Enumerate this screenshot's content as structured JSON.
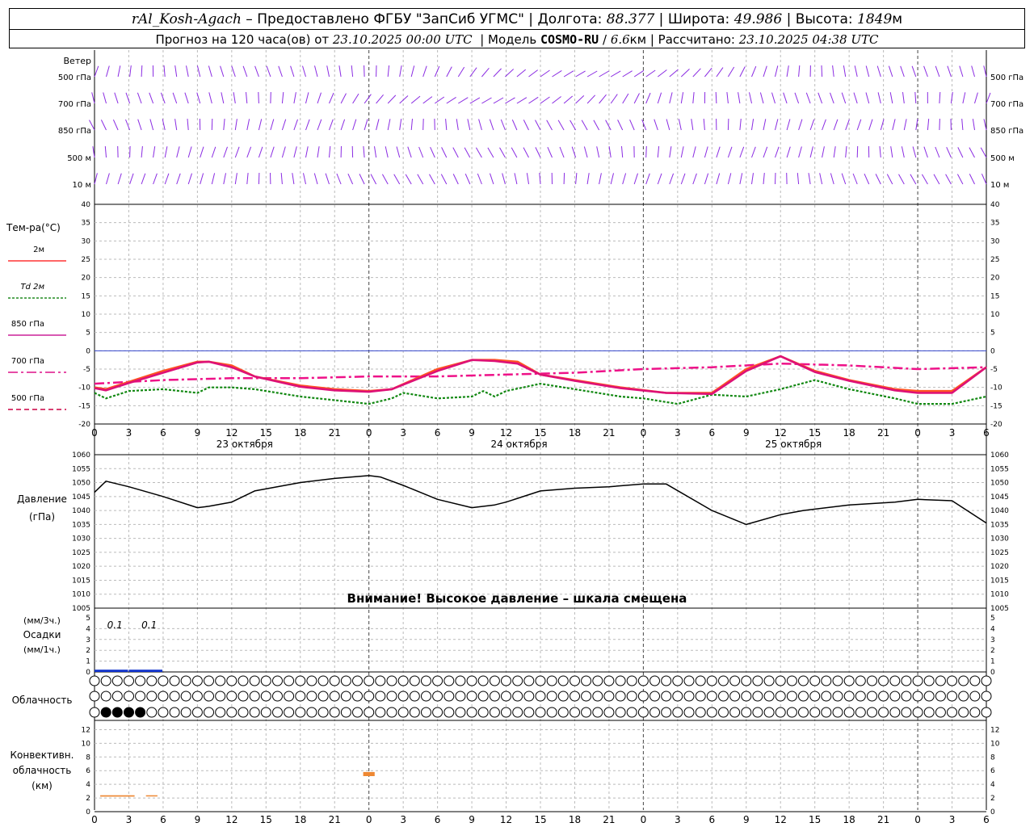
{
  "header": {
    "station": "rAl_Kosh-Agach",
    "provider": "– Предоставлено ФГБУ \"ЗапСиб УГМС\"",
    "lon_label": "Долгота:",
    "lon_value": "88.377",
    "lat_label": "Широта:",
    "lat_value": "49.986",
    "alt_label": "Высота:",
    "alt_value": "1849",
    "alt_unit": "м",
    "forecast_label": "Прогноз на 120 часа(ов) от",
    "forecast_start": "23.10.2025 00:00 UTC",
    "model_label": "Модель",
    "model_name": "COSMO-RU",
    "model_res": "6.6",
    "model_res_unit": "км",
    "computed_label": "Рассчитано:",
    "computed_time": "23.10.2025 04:38 UTC"
  },
  "warning": "Внимание! Высокое давление – шкала смещена",
  "chart_data": {
    "type": "line",
    "hours": [
      0,
      3,
      6,
      9,
      12,
      15,
      18,
      21,
      24,
      27,
      30,
      33,
      36,
      39,
      42,
      45,
      48,
      51,
      54,
      57,
      60,
      63,
      66,
      69,
      72,
      75,
      78
    ],
    "x_tick_labels": [
      "0",
      "3",
      "6",
      "9",
      "12",
      "15",
      "18",
      "21",
      "0",
      "3",
      "6",
      "9",
      "12",
      "15",
      "18",
      "21",
      "0",
      "3",
      "6",
      "9",
      "12",
      "15",
      "18",
      "21",
      "0",
      "3",
      "6"
    ],
    "date_labels": [
      {
        "hour": 12,
        "text": "23 октября"
      },
      {
        "hour": 36,
        "text": "24 октября"
      },
      {
        "hour": 60,
        "text": "25 октября"
      }
    ],
    "wind": {
      "title": "Ветер",
      "levels": [
        "500 гПа",
        "700 гПа",
        "850 гПа",
        "500 м",
        "10 м"
      ]
    },
    "temperature": {
      "ylabel": "Тем-ра(°C)",
      "ylim": [
        -20,
        40
      ],
      "ticks": [
        -20,
        -15,
        -10,
        -5,
        0,
        5,
        10,
        15,
        20,
        25,
        30,
        35,
        40
      ],
      "legend": [
        {
          "label": "2м",
          "color": "#ff3333",
          "dash": "solid"
        },
        {
          "label": "Td 2м",
          "color": "#228b22",
          "dash": "dotted"
        },
        {
          "label": "850 гПа",
          "color": "#cc2299",
          "dash": "solid"
        },
        {
          "label": "700 гПа",
          "color": "#dd1188",
          "dash": "dashdot"
        },
        {
          "label": "500 гПа",
          "color": "#cc0044",
          "dash": "dashed"
        }
      ],
      "series": [
        {
          "name": "2м",
          "color": "#ff5522",
          "x": [
            0,
            1,
            3,
            6,
            9,
            10,
            12,
            14,
            18,
            21,
            24,
            26,
            30,
            33,
            35,
            37,
            39,
            42,
            46,
            50,
            54,
            57,
            60,
            63,
            66,
            70,
            72,
            75,
            78
          ],
          "y": [
            -10,
            -10.5,
            -8.5,
            -5.5,
            -3,
            -3,
            -4,
            -7,
            -9.5,
            -10.5,
            -11,
            -10.5,
            -5,
            -2.5,
            -2.5,
            -3,
            -6.5,
            -8,
            -10,
            -11.5,
            -11.5,
            -5,
            -1.5,
            -5.5,
            -8,
            -10.5,
            -11,
            -11,
            -4.5
          ]
        },
        {
          "name": "850 гПа",
          "color": "#dd1177",
          "x": [
            0,
            1,
            3,
            6,
            9,
            10,
            12,
            14,
            18,
            21,
            24,
            26,
            30,
            33,
            35,
            37,
            39,
            42,
            46,
            50,
            54,
            57,
            60,
            63,
            66,
            70,
            72,
            75,
            78
          ],
          "y": [
            -10.2,
            -10.8,
            -8.8,
            -6,
            -3.2,
            -3,
            -4.5,
            -7,
            -9.8,
            -10.8,
            -11.2,
            -10.5,
            -5.5,
            -2.5,
            -2.8,
            -3.5,
            -6.5,
            -8.2,
            -10.2,
            -11.5,
            -11.8,
            -5.5,
            -1.5,
            -5.8,
            -8.2,
            -10.8,
            -11.5,
            -11.5,
            -4.5
          ]
        },
        {
          "name": "700 гПа",
          "color": "#ee1188",
          "x": [
            0,
            6,
            12,
            18,
            24,
            30,
            36,
            42,
            48,
            54,
            60,
            66,
            72,
            78
          ],
          "y": [
            -9,
            -8,
            -7.5,
            -7.5,
            -7,
            -7,
            -6.5,
            -6,
            -5,
            -4.5,
            -3.5,
            -4,
            -5,
            -4.5
          ]
        },
        {
          "name": "Td 2м",
          "color": "#118811",
          "x": [
            0,
            1,
            3,
            6,
            9,
            10,
            12,
            14,
            18,
            21,
            24,
            26,
            27,
            30,
            33,
            34,
            35,
            36,
            39,
            42,
            46,
            48,
            51,
            54,
            57,
            60,
            63,
            66,
            70,
            72,
            75,
            78
          ],
          "y": [
            -11.5,
            -13,
            -11,
            -10.5,
            -11.5,
            -10,
            -10,
            -10.5,
            -12.5,
            -13.5,
            -14.5,
            -13,
            -11.5,
            -13,
            -12.5,
            -11,
            -12.5,
            -11,
            -9,
            -10.5,
            -12.5,
            -13,
            -14.5,
            -12,
            -12.5,
            -10.5,
            -8,
            -10.5,
            -13,
            -14.5,
            -14.5,
            -12.5
          ]
        }
      ]
    },
    "pressure": {
      "ylabel": "Давление",
      "unit": "(гПа)",
      "ylim": [
        1005,
        1060
      ],
      "ticks": [
        1005,
        1010,
        1015,
        1020,
        1025,
        1030,
        1035,
        1040,
        1045,
        1050,
        1055,
        1060
      ],
      "x": [
        0,
        1,
        3,
        6,
        9,
        10,
        12,
        14,
        18,
        21,
        24,
        25,
        27,
        30,
        33,
        35,
        36,
        39,
        42,
        45,
        48,
        50,
        54,
        57,
        60,
        62,
        66,
        70,
        72,
        75,
        78
      ],
      "y": [
        1046.5,
        1050.5,
        1048.5,
        1045,
        1041,
        1041.5,
        1043,
        1047,
        1050,
        1051.5,
        1052.5,
        1052,
        1049,
        1044,
        1041,
        1042,
        1043,
        1047,
        1048,
        1048.5,
        1049.5,
        1049.5,
        1040,
        1035,
        1038.5,
        1040,
        1042,
        1043,
        1044,
        1043.5,
        1035.5
      ]
    },
    "precip": {
      "ylabel": "Осадки",
      "unit_3h": "(мм/3ч.)",
      "unit_1h": "(мм/1ч.)",
      "ylim": [
        0,
        5
      ],
      "ticks": [
        0,
        1,
        2,
        3,
        4,
        5
      ],
      "bars": [
        {
          "hour": 1,
          "value": 0.1,
          "label": "0.1"
        },
        {
          "hour": 4,
          "value": 0.1,
          "label": "0.1"
        }
      ],
      "color": "#1133cc"
    },
    "cloud": {
      "ylabel": "Облачность",
      "rows": 3
    },
    "convective": {
      "ylabel": "Конвективн.",
      "ylabel2": "облачность",
      "unit": "(км)",
      "ylim": [
        0,
        13
      ],
      "ticks": [
        0,
        2,
        4,
        6,
        8,
        10,
        12
      ],
      "segments": [
        {
          "h0": 0.5,
          "h1": 3.5,
          "low": 2.2,
          "high": 2.4
        },
        {
          "h0": 4.5,
          "h1": 5.5,
          "low": 2.3,
          "high": 2.4
        },
        {
          "h0": 23.5,
          "h1": 24.5,
          "low": 5.2,
          "high": 5.8
        }
      ],
      "color": "#ee8833"
    }
  }
}
